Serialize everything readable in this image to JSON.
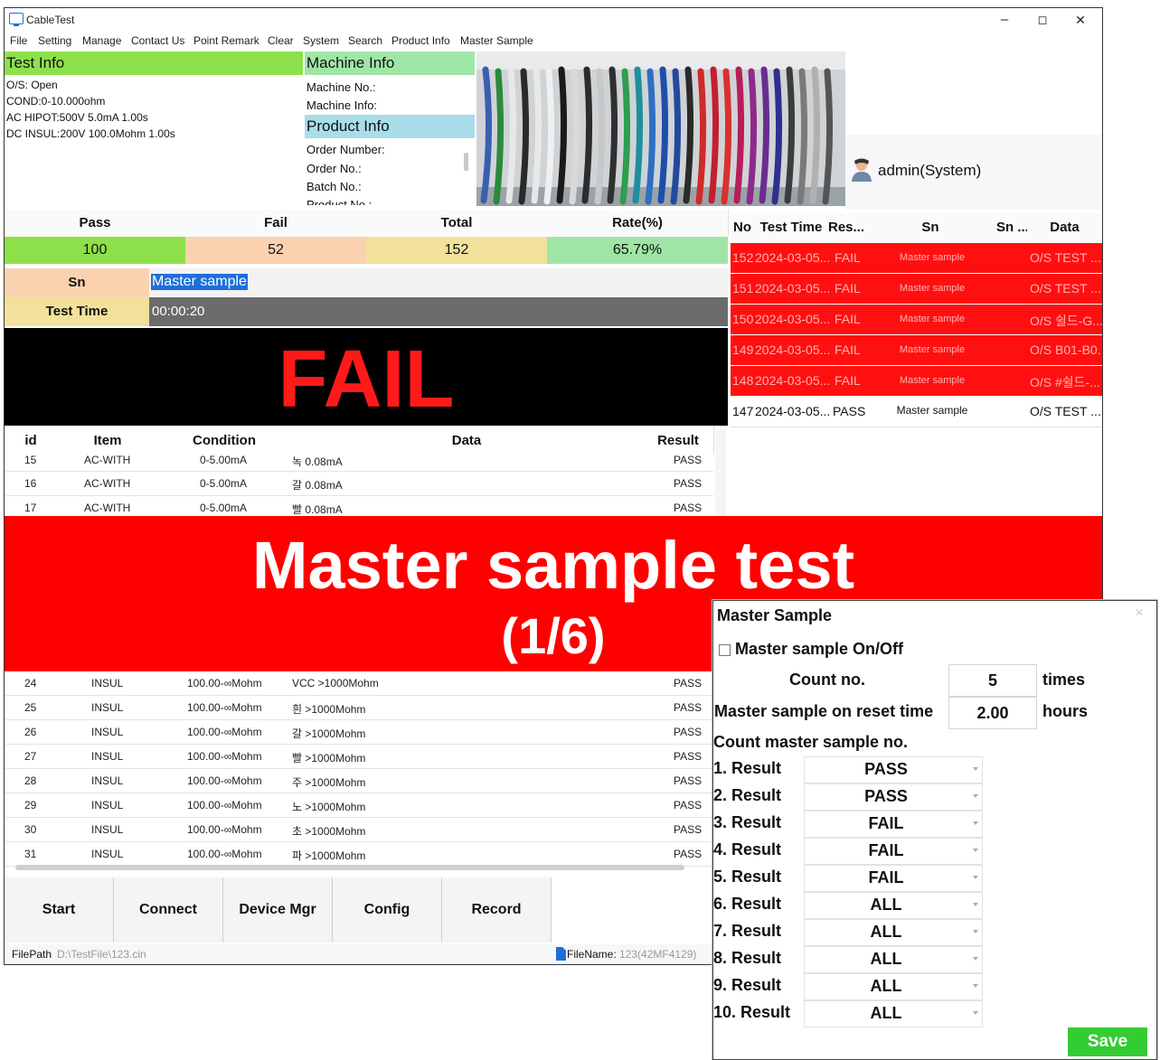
{
  "window": {
    "title": "CableTest",
    "minimize": "–",
    "maximize": "◻",
    "close": "✕"
  },
  "menu": [
    "File",
    "Setting",
    "Manage",
    "Contact Us",
    "Point Remark",
    "Clear",
    "System",
    "Search",
    "Product Info",
    "Master Sample"
  ],
  "test_info": {
    "title": "Test Info",
    "lines": [
      "O/S: Open",
      "COND:0-10.000ohm",
      "AC HIPOT:500V 5.0mA 1.00s",
      "DC INSUL:200V 100.0Mohm 1.00s"
    ]
  },
  "machine_info": {
    "title": "Machine Info",
    "machine_no": "Machine No.:",
    "machine_info": "Machine Info:"
  },
  "product_info": {
    "title": "Product Info",
    "lines": [
      "Order Number:",
      "Order No.:",
      "Batch No.:",
      "Product No.:"
    ]
  },
  "user": {
    "name": "admin(System)"
  },
  "stats": {
    "pass_label": "Pass",
    "fail_label": "Fail",
    "total_label": "Total",
    "rate_label": "Rate(%)",
    "pass": "100",
    "fail": "52",
    "total": "152",
    "rate": "65.79%",
    "colors": {
      "pass": "#8ee04a",
      "fail": "#fbd2b0",
      "total": "#f2e19a",
      "rate": "#9fe6a6"
    }
  },
  "sn": {
    "label": "Sn",
    "value": "Master sample"
  },
  "test_time": {
    "label": "Test Time",
    "value": "00:00:20"
  },
  "result_banner": {
    "text": "FAIL",
    "color": "#ff1a1a"
  },
  "table": {
    "headers": [
      "id",
      "Item",
      "Condition",
      "Data",
      "Result"
    ],
    "rows_top": [
      {
        "id": "15",
        "item": "AC-WITH",
        "cond": "0-5.00mA",
        "data": "녹 0.08mA",
        "result": "PASS"
      },
      {
        "id": "16",
        "item": "AC-WITH",
        "cond": "0-5.00mA",
        "data": "갈 0.08mA",
        "result": "PASS"
      },
      {
        "id": "17",
        "item": "AC-WITH",
        "cond": "0-5.00mA",
        "data": "빨 0.08mA",
        "result": "PASS"
      }
    ],
    "rows_bottom": [
      {
        "id": "24",
        "item": "INSUL",
        "cond": "100.00-∞Mohm",
        "data": "VCC >1000Mohm",
        "result": "PASS"
      },
      {
        "id": "25",
        "item": "INSUL",
        "cond": "100.00-∞Mohm",
        "data": "흰 >1000Mohm",
        "result": "PASS"
      },
      {
        "id": "26",
        "item": "INSUL",
        "cond": "100.00-∞Mohm",
        "data": "갈 >1000Mohm",
        "result": "PASS"
      },
      {
        "id": "27",
        "item": "INSUL",
        "cond": "100.00-∞Mohm",
        "data": "빨 >1000Mohm",
        "result": "PASS"
      },
      {
        "id": "28",
        "item": "INSUL",
        "cond": "100.00-∞Mohm",
        "data": "주 >1000Mohm",
        "result": "PASS"
      },
      {
        "id": "29",
        "item": "INSUL",
        "cond": "100.00-∞Mohm",
        "data": "노 >1000Mohm",
        "result": "PASS"
      },
      {
        "id": "30",
        "item": "INSUL",
        "cond": "100.00-∞Mohm",
        "data": "초 >1000Mohm",
        "result": "PASS"
      },
      {
        "id": "31",
        "item": "INSUL",
        "cond": "100.00-∞Mohm",
        "data": "파 >1000Mohm",
        "result": "PASS"
      }
    ]
  },
  "results": {
    "headers": [
      "No",
      "Test Time",
      "Res...",
      "Sn",
      "Sn ...",
      "Data"
    ],
    "rows": [
      {
        "no": "152",
        "time": "2024-03-05...",
        "res": "FAIL",
        "sn": "Master sample",
        "sn2": "",
        "data": "O/S TEST ...",
        "status": "fail"
      },
      {
        "no": "151",
        "time": "2024-03-05...",
        "res": "FAIL",
        "sn": "Master sample",
        "sn2": "",
        "data": "O/S TEST ...",
        "status": "fail"
      },
      {
        "no": "150",
        "time": "2024-03-05...",
        "res": "FAIL",
        "sn": "Master sample",
        "sn2": "",
        "data": "O/S 쉴드-G...",
        "status": "fail"
      },
      {
        "no": "149",
        "time": "2024-03-05...",
        "res": "FAIL",
        "sn": "Master sample",
        "sn2": "",
        "data": "O/S B01-B0...",
        "status": "fail"
      },
      {
        "no": "148",
        "time": "2024-03-05...",
        "res": "FAIL",
        "sn": "Master sample",
        "sn2": "",
        "data": "O/S #쉴드-...",
        "status": "fail"
      },
      {
        "no": "147",
        "time": "2024-03-05...",
        "res": "PASS",
        "sn": "Master sample",
        "sn2": "",
        "data": "O/S TEST ...",
        "status": "pass"
      }
    ]
  },
  "master_banner": {
    "line1": "Master sample test",
    "line2": "(1/6)"
  },
  "buttons": [
    "Start",
    "Connect",
    "Device Mgr",
    "Config",
    "Record"
  ],
  "status": {
    "filepath_label": "FilePath",
    "filepath": "D:\\TestFile\\123.cin",
    "filename_label": "FileName:",
    "filename": "123(42MF4129)"
  },
  "dialog": {
    "title": "Master Sample",
    "onoff_label": "Master sample On/Off",
    "onoff_checked": false,
    "count_label": "Count no.",
    "count_value": "5",
    "count_unit": "times",
    "reset_label": "Master sample on reset time",
    "reset_value": "2.00",
    "reset_unit": "hours",
    "list_label": "Count master sample no.",
    "results": [
      {
        "label": "1. Result",
        "value": "PASS"
      },
      {
        "label": "2. Result",
        "value": "PASS"
      },
      {
        "label": "3. Result",
        "value": "FAIL"
      },
      {
        "label": "4. Result",
        "value": "FAIL"
      },
      {
        "label": "5. Result",
        "value": "FAIL"
      },
      {
        "label": "6. Result",
        "value": "ALL"
      },
      {
        "label": "7. Result",
        "value": "ALL"
      },
      {
        "label": "8. Result",
        "value": "ALL"
      },
      {
        "label": "9. Result",
        "value": "ALL"
      },
      {
        "label": "10. Result",
        "value": "ALL"
      }
    ],
    "save_label": "Save"
  }
}
